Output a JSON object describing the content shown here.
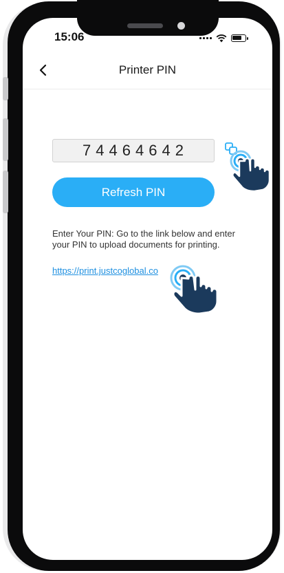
{
  "status_bar": {
    "time": "15:06"
  },
  "header": {
    "title": "Printer PIN"
  },
  "pin": {
    "value": "74464642"
  },
  "refresh_button": {
    "label": "Refresh PIN"
  },
  "instructions": {
    "text": "Enter Your PIN: Go to the link below and enter your PIN to upload documents for printing."
  },
  "link": {
    "text": "https://print.justcoglobal.co"
  },
  "icons": [
    "back-chevron-icon",
    "copy-icon",
    "pointer-hand-icon"
  ],
  "colors": {
    "accent": "#2aaef6",
    "link": "#1d8fe0",
    "hand": "#1b3a5c"
  }
}
